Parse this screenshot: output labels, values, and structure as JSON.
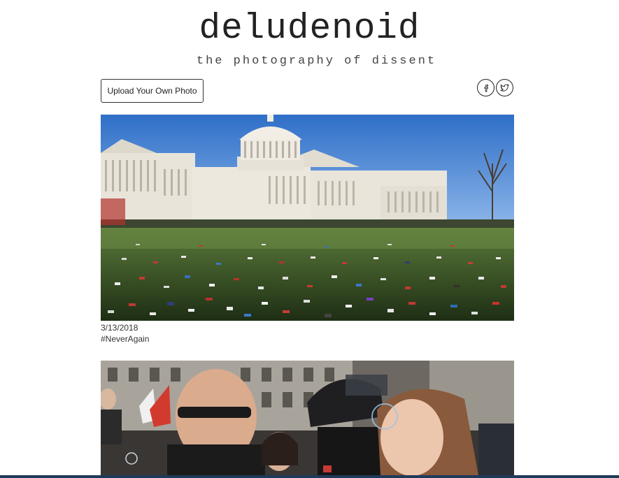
{
  "header": {
    "title": "deludenoid",
    "tagline": "the photography of dissent"
  },
  "toolbar": {
    "upload_label": "Upload Your Own Photo",
    "social_icons": [
      "facebook-icon",
      "twitter-icon"
    ]
  },
  "posts": [
    {
      "date": "3/13/2018",
      "tag": "#NeverAgain"
    },
    {
      "date": "",
      "tag": ""
    }
  ],
  "colors": {
    "bottom_bar": "#1f3a5a",
    "sky": "#3d7fd1",
    "grass": "#2f4a22"
  }
}
